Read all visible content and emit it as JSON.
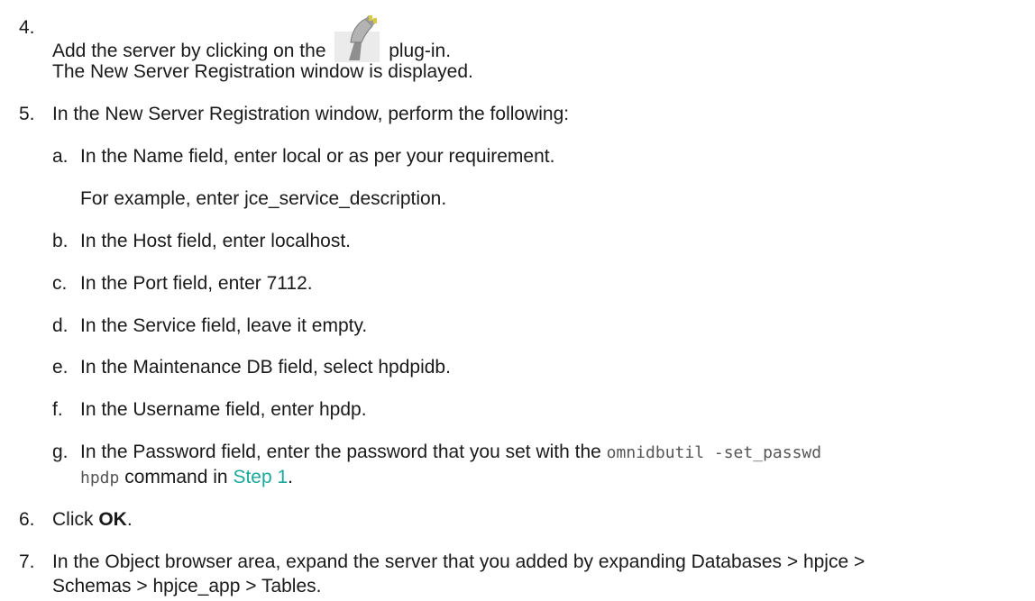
{
  "steps": {
    "s4": {
      "num": "4.",
      "text_before": "Add the server by clicking on the",
      "icon": "plug-in-icon",
      "text_after": "plug-in.",
      "sub": "The New Server Registration window is displayed."
    },
    "s5": {
      "num": "5.",
      "text": "In the New Server Registration window, perform the following:",
      "a": {
        "letter": "a.",
        "text": "In the Name field, enter local or as per your requirement.",
        "sub": "For example, enter jce_service_description."
      },
      "b": {
        "letter": "b.",
        "text": "In the Host field, enter localhost."
      },
      "c": {
        "letter": "c.",
        "text": "In the Port field, enter 7112."
      },
      "d": {
        "letter": "d.",
        "text": "In the Service field, leave it empty."
      },
      "e": {
        "letter": "e.",
        "text": "In the Maintenance DB field, select hpdpidb."
      },
      "f": {
        "letter": "f.",
        "text": "In the Username field, enter hpdp."
      },
      "g": {
        "letter": "g.",
        "text_before": "In the Password field, enter the password that you set with the",
        "code1": "omnidbutil -set_passwd",
        "code2": "hpdp",
        "text_mid": "command in",
        "link": "Step 1",
        "text_end": "."
      }
    },
    "s6": {
      "num": "6.",
      "text_before": "Click",
      "bold": "OK",
      "text_after": "."
    },
    "s7": {
      "num": "7.",
      "line1": "In the Object browser area, expand the server that you added by expanding Databases > hpjce >",
      "line2": "Schemas > hpjce_app > Tables."
    }
  }
}
